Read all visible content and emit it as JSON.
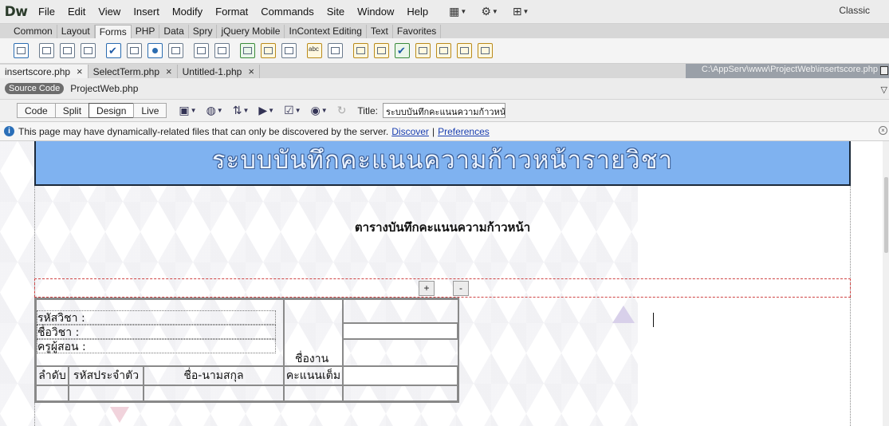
{
  "app": {
    "logo": "Dw",
    "workspace": "Classic",
    "menu": [
      "File",
      "Edit",
      "View",
      "Insert",
      "Modify",
      "Format",
      "Commands",
      "Site",
      "Window",
      "Help"
    ]
  },
  "insert_tabs": [
    "Common",
    "Layout",
    "Forms",
    "PHP",
    "Data",
    "Spry",
    "jQuery Mobile",
    "InContext Editing",
    "Text",
    "Favorites"
  ],
  "insert_active_tab": "Forms",
  "doc_tabs": [
    {
      "label": "insertscore.php",
      "active": true
    },
    {
      "label": "SelectTerm.php",
      "active": false
    },
    {
      "label": "Untitled-1.php",
      "active": false
    }
  ],
  "file_path": "C:\\AppServ\\www\\ProjectWeb\\insertscore.php",
  "related": {
    "source_code": "Source Code",
    "file": "ProjectWeb.php"
  },
  "doc_toolbar": {
    "views": [
      "Code",
      "Split",
      "Design",
      "Live"
    ],
    "active_view": "Design",
    "title_label": "Title:",
    "title_value": "ระบบบันทึกคะแนนความก้าวหน้า"
  },
  "info_bar": {
    "message": "This page may have dynamically-related files that can only be discovered by the server.",
    "discover": "Discover",
    "separator": "|",
    "preferences": "Preferences"
  },
  "page": {
    "banner_title": "ระบบบันทึกคะแนนความก้าวหน้ารายวิชา",
    "subtitle": "ตารางบันทึกคะแนนความก้าวหน้า",
    "plus": "+",
    "minus": "-",
    "course_code_label": "รหัสวิชา :",
    "course_name_label": "ชื่อวิชา :",
    "teacher_label": "ครูผู้สอน :",
    "work_name": "ชื่องาน",
    "col_no": "ลำดับ",
    "col_id": "รหัสประจำตัว",
    "col_name": "ชื่อ-นามสกุล",
    "col_full": "คะแนนเต็ม"
  }
}
